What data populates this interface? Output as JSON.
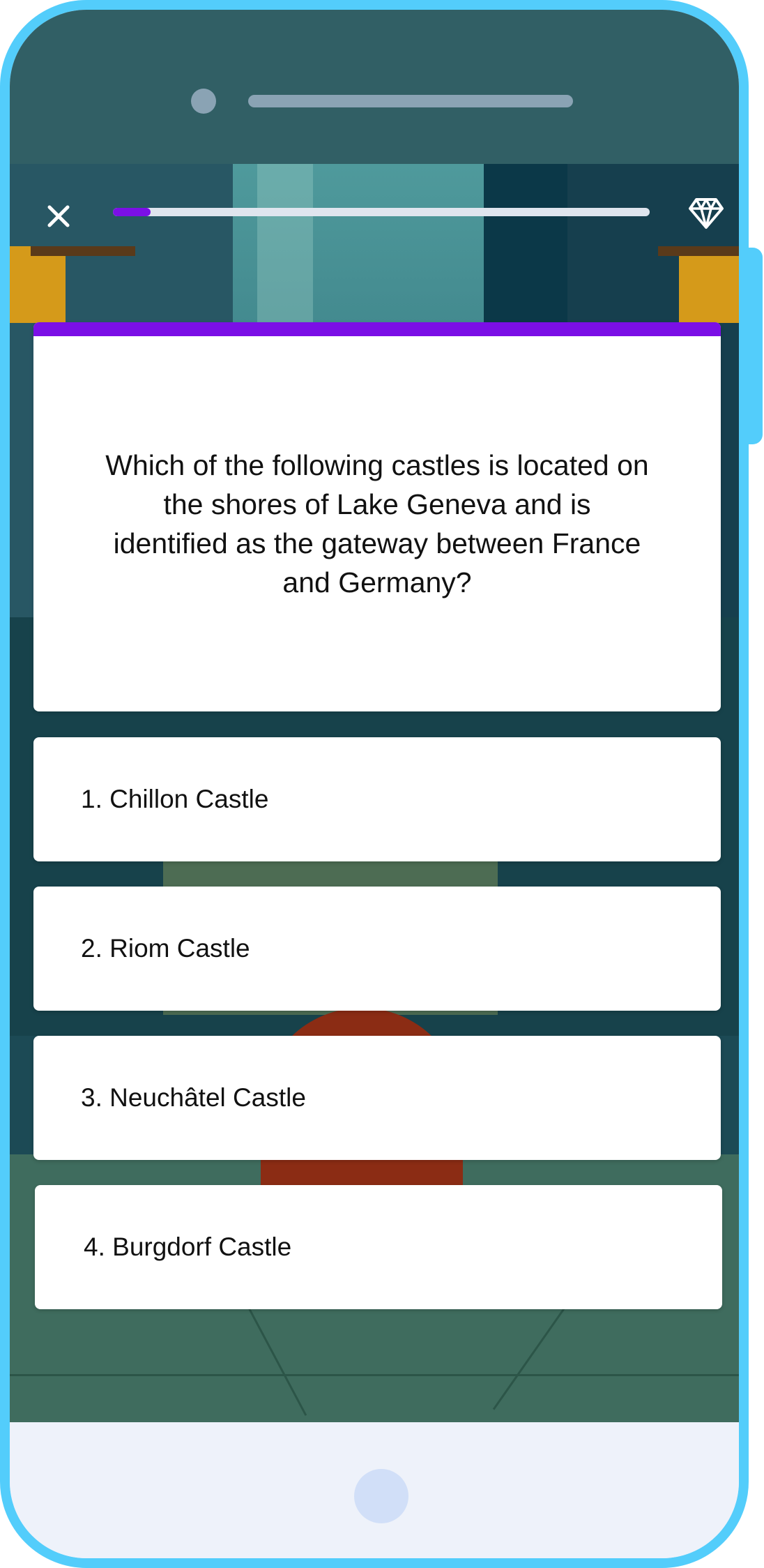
{
  "header": {
    "close_icon": "close-icon",
    "gem_icon": "diamond-icon",
    "progress_fraction": 0.07,
    "progress_color": "#7b0fe6"
  },
  "question": {
    "text": "Which of the following castles is located on the shores of Lake Geneva and is identified as the gateway between France and Germany?",
    "accent_color": "#7b0fe6"
  },
  "options": [
    {
      "label": "1. Chillon Castle"
    },
    {
      "label": "2. Riom Castle"
    },
    {
      "label": "3. Neuchâtel Castle"
    },
    {
      "label": "4. Burgdorf Castle"
    }
  ],
  "device": {
    "frame_color": "#53cdfb",
    "home_button_color": "#d1dff8"
  }
}
